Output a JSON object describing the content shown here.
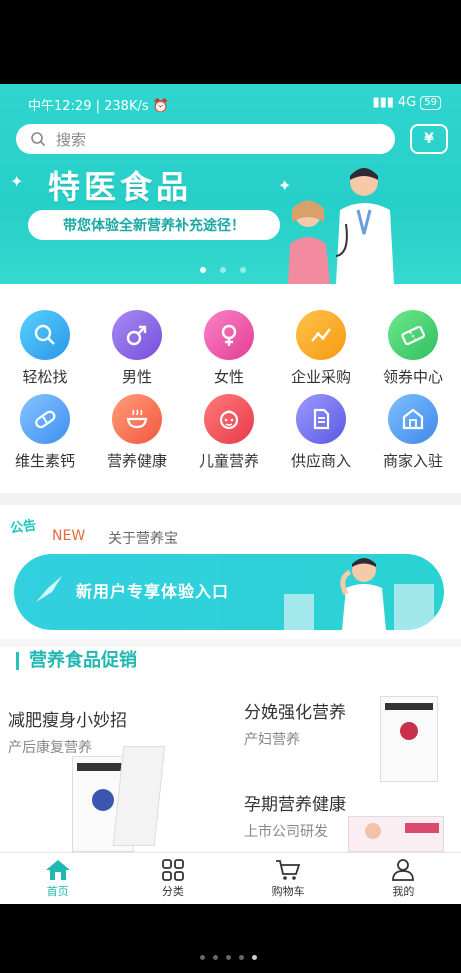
{
  "status": {
    "time": "中午12:29",
    "speed": "238K/s",
    "network": "4G",
    "battery": "59"
  },
  "search": {
    "placeholder": "搜索"
  },
  "coupon_icon_label": "¥",
  "banner": {
    "title": "特医食品",
    "pill": "带您体验全新营养补充途径！"
  },
  "categories": [
    {
      "label": "轻松找",
      "icon": "search-icon",
      "color": "#2fb2ef"
    },
    {
      "label": "男性",
      "icon": "male-icon",
      "color": "#8b63e6"
    },
    {
      "label": "女性",
      "icon": "female-icon",
      "color": "#ef4fa6"
    },
    {
      "label": "企业采购",
      "icon": "trend-icon",
      "color": "#f7a71c"
    },
    {
      "label": "领券中心",
      "icon": "ticket-icon",
      "color": "#3ecf6f"
    },
    {
      "label": "维生素钙",
      "icon": "pill-icon",
      "color": "#55a6f7"
    },
    {
      "label": "营养健康",
      "icon": "bowl-icon",
      "color": "#f5725a"
    },
    {
      "label": "儿童营养",
      "icon": "child-icon",
      "color": "#ef4f5a"
    },
    {
      "label": "供应商入",
      "icon": "document-icon",
      "color": "#6e6de8"
    },
    {
      "label": "商家入驻",
      "icon": "store-icon",
      "color": "#4f9bf0"
    }
  ],
  "notice": {
    "badge": "公告",
    "tag": "NEW",
    "text": "关于营养宝"
  },
  "promo": {
    "text": "新用户专享体验入口"
  },
  "section": {
    "title": "营养食品促销"
  },
  "products": [
    {
      "name": "减肥瘦身小妙招",
      "sub": "产后康复营养"
    },
    {
      "name": "分娩强化营养",
      "sub": "产妇营养"
    },
    {
      "name": "孕期营养健康",
      "sub": "上市公司研发"
    }
  ],
  "tabs": [
    {
      "label": "首页",
      "icon": "home-icon"
    },
    {
      "label": "分类",
      "icon": "grid-icon"
    },
    {
      "label": "购物车",
      "icon": "cart-icon"
    },
    {
      "label": "我的",
      "icon": "user-icon"
    }
  ],
  "colors": {
    "accent": "#20b9b2",
    "banner": "#2fd6d0"
  }
}
